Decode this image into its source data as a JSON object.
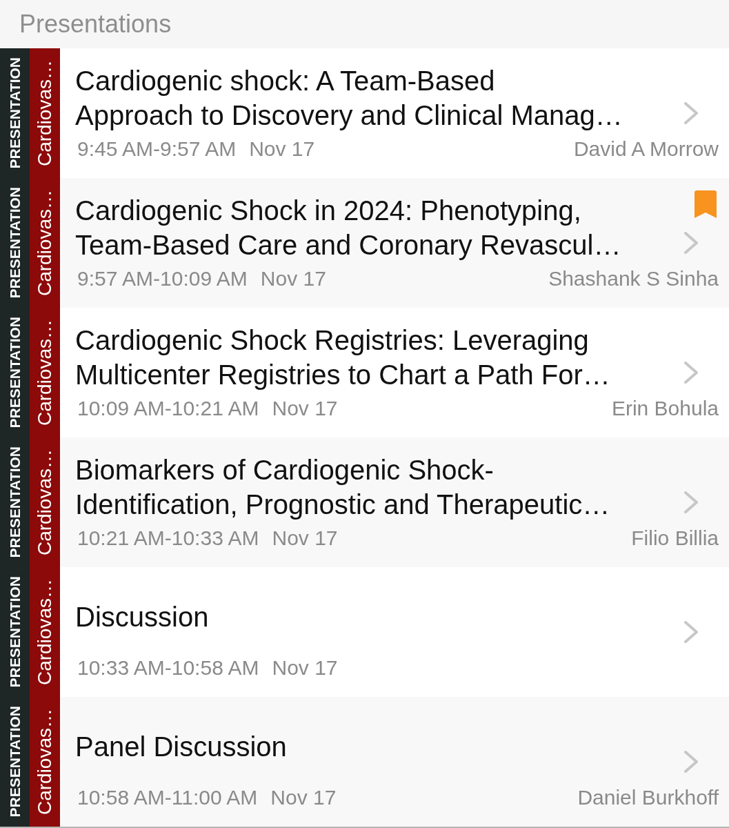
{
  "header": {
    "title": "Presentations"
  },
  "presentations": [
    {
      "type_label": "PRESENTATION",
      "track": "Cardiovas…",
      "title": "Cardiogenic shock: A Team-Based\nApproach to Discovery and Clinical Manag…",
      "time": "9:45 AM-9:57 AM",
      "date": "Nov 17",
      "speaker": "David A Morrow",
      "bookmarked": false
    },
    {
      "type_label": "PRESENTATION",
      "track": "Cardiovas…",
      "title": "Cardiogenic Shock in 2024: Phenotyping,\nTeam-Based Care and Coronary Revascul…",
      "time": "9:57 AM-10:09 AM",
      "date": "Nov 17",
      "speaker": "Shashank S Sinha",
      "bookmarked": true
    },
    {
      "type_label": "PRESENTATION",
      "track": "Cardiovas…",
      "title": "Cardiogenic Shock Registries: Leveraging\nMulticenter Registries to Chart a Path For…",
      "time": "10:09 AM-10:21 AM",
      "date": "Nov 17",
      "speaker": "Erin Bohula",
      "bookmarked": false
    },
    {
      "type_label": "PRESENTATION",
      "track": "Cardiovas…",
      "title": "Biomarkers of Cardiogenic Shock-\nIdentification, Prognostic and Therapeutic…",
      "time": "10:21 AM-10:33 AM",
      "date": "Nov 17",
      "speaker": "Filio Billia",
      "bookmarked": false
    },
    {
      "type_label": "PRESENTATION",
      "track": "Cardiovas…",
      "title": "Discussion",
      "time": "10:33 AM-10:58 AM",
      "date": "Nov 17",
      "bookmarked": false
    },
    {
      "type_label": "PRESENTATION",
      "track": "Cardiovas…",
      "title": "Panel Discussion",
      "time": "10:58 AM-11:00 AM",
      "date": "Nov 17",
      "speaker": "Daniel Burkhoff",
      "bookmarked": false
    }
  ]
}
